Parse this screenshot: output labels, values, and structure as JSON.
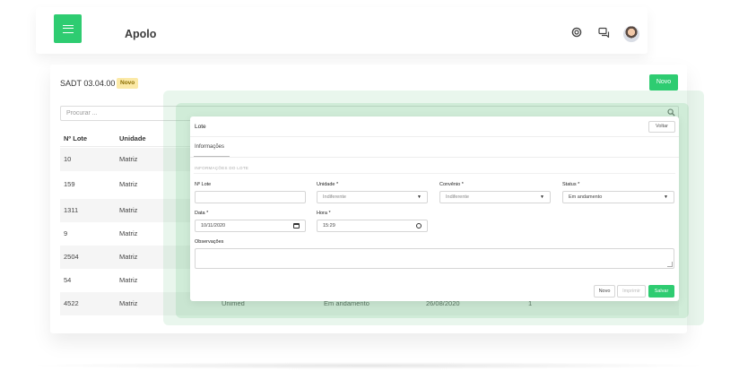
{
  "header": {
    "app_title": "Apolo",
    "icons": [
      "support-icon",
      "chat-icon",
      "user-avatar"
    ],
    "accent_color": "#2ecc71"
  },
  "page": {
    "title": "SADT 03.04.00",
    "badge": "Novo",
    "new_button": "Novo",
    "search_placeholder": "Procurar ..."
  },
  "table": {
    "columns": [
      "Nº Lote",
      "Unidade"
    ],
    "rows": [
      {
        "lote": "10",
        "unidade": "Matriz"
      },
      {
        "lote": "159",
        "unidade": "Matriz"
      },
      {
        "lote": "1311",
        "unidade": "Matriz"
      },
      {
        "lote": "9",
        "unidade": "Matriz"
      },
      {
        "lote": "2504",
        "unidade": "Matriz"
      },
      {
        "lote": "54",
        "unidade": "Matriz"
      },
      {
        "lote": "4522",
        "unidade": "Matriz",
        "convenio": "Unimed",
        "status": "Em andamento",
        "data": "26/08/2020",
        "extra": "1"
      }
    ]
  },
  "modal": {
    "title": "Lote",
    "back_button": "Voltar",
    "tab": "Informações",
    "section": "INFORMAÇÕES DO LOTE",
    "fields": {
      "lote": {
        "label": "Nº Lote",
        "value": ""
      },
      "unidade": {
        "label": "Unidade *",
        "value": "Indiferente"
      },
      "convenio": {
        "label": "Convênio *",
        "value": "Indiferente"
      },
      "status": {
        "label": "Status *",
        "value": "Em andamento"
      },
      "data": {
        "label": "Data *",
        "value": "10/11/2020"
      },
      "hora": {
        "label": "Hora *",
        "value": "15:29"
      },
      "observacoes": {
        "label": "Observações",
        "value": ""
      }
    },
    "buttons": {
      "new": "Novo",
      "print": "Imprimir",
      "save": "Salvar"
    }
  }
}
